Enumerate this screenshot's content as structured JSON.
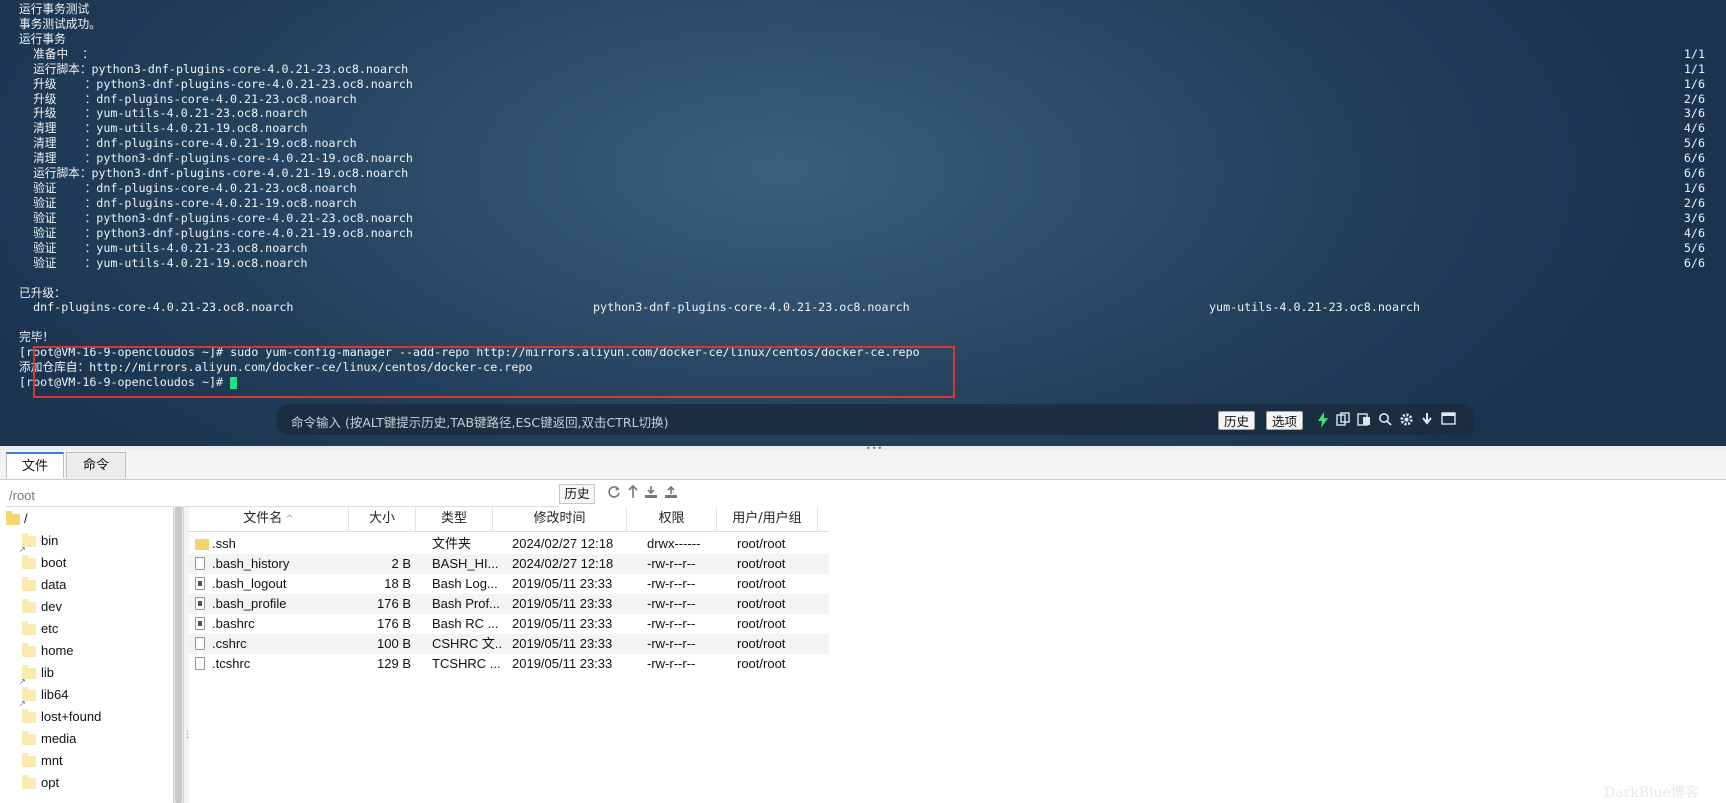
{
  "terminal": {
    "lines": [
      {
        "left": "运行事务测试"
      },
      {
        "left": "事务测试成功。"
      },
      {
        "left": "运行事务"
      },
      {
        "left": "  准备中  ：",
        "right": "1/1"
      },
      {
        "left": "  运行脚本：python3-dnf-plugins-core-4.0.21-23.oc8.noarch",
        "right": "1/1"
      },
      {
        "left": "  升级    ：python3-dnf-plugins-core-4.0.21-23.oc8.noarch",
        "right": "1/6"
      },
      {
        "left": "  升级    ：dnf-plugins-core-4.0.21-23.oc8.noarch",
        "right": "2/6"
      },
      {
        "left": "  升级    ：yum-utils-4.0.21-23.oc8.noarch",
        "right": "3/6"
      },
      {
        "left": "  清理    ：yum-utils-4.0.21-19.oc8.noarch",
        "right": "4/6"
      },
      {
        "left": "  清理    ：dnf-plugins-core-4.0.21-19.oc8.noarch",
        "right": "5/6"
      },
      {
        "left": "  清理    ：python3-dnf-plugins-core-4.0.21-19.oc8.noarch",
        "right": "6/6"
      },
      {
        "left": "  运行脚本：python3-dnf-plugins-core-4.0.21-19.oc8.noarch",
        "right": "6/6"
      },
      {
        "left": "  验证    ：dnf-plugins-core-4.0.21-23.oc8.noarch",
        "right": "1/6"
      },
      {
        "left": "  验证    ：dnf-plugins-core-4.0.21-19.oc8.noarch",
        "right": "2/6"
      },
      {
        "left": "  验证    ：python3-dnf-plugins-core-4.0.21-23.oc8.noarch",
        "right": "3/6"
      },
      {
        "left": "  验证    ：python3-dnf-plugins-core-4.0.21-19.oc8.noarch",
        "right": "4/6"
      },
      {
        "left": "  验证    ：yum-utils-4.0.21-23.oc8.noarch",
        "right": "5/6"
      },
      {
        "left": "  验证    ：yum-utils-4.0.21-19.oc8.noarch",
        "right": "6/6"
      },
      {
        "left": ""
      },
      {
        "left": "已升级："
      },
      {
        "left": "  dnf-plugins-core-4.0.21-23.oc8.noarch",
        "mid": "python3-dnf-plugins-core-4.0.21-23.oc8.noarch",
        "far": "yum-utils-4.0.21-23.oc8.noarch"
      },
      {
        "left": ""
      },
      {
        "left": "完毕！"
      },
      {
        "left": "[root@VM-16-9-opencloudos ~]# sudo yum-config-manager --add-repo http://mirrors.aliyun.com/docker-ce/linux/centos/docker-ce.repo"
      },
      {
        "left": "添加仓库自：http://mirrors.aliyun.com/docker-ce/linux/centos/docker-ce.repo"
      },
      {
        "left": "[root@VM-16-9-opencloudos ~]# ",
        "cursor": true
      }
    ],
    "command_bar": {
      "placeholder": "命令输入 (按ALT键提示历史,TAB键路径,ESC键返回,双击CTRL切换)",
      "history_label": "历史",
      "options_label": "选项",
      "icons": [
        "lightning-icon",
        "copy-icon",
        "paste-icon",
        "search-icon",
        "gear-icon",
        "download-arrow-icon",
        "window-icon"
      ]
    }
  },
  "tabs": [
    {
      "label": "文件",
      "active": true
    },
    {
      "label": "命令",
      "active": false
    }
  ],
  "path_bar": {
    "placeholder": "/root",
    "history_label": "历史",
    "icons": [
      "refresh-icon",
      "up-icon",
      "download-icon",
      "upload-icon"
    ]
  },
  "tree": {
    "root": "/",
    "items": [
      "bin",
      "boot",
      "data",
      "dev",
      "etc",
      "home",
      "lib",
      "lib64",
      "lost+found",
      "media",
      "mnt",
      "opt"
    ],
    "link_items": [
      "bin",
      "lib",
      "lib64"
    ]
  },
  "file_table": {
    "columns": [
      "文件名",
      "大小",
      "类型",
      "修改时间",
      "权限",
      "用户/用户组"
    ],
    "rows": [
      {
        "name": ".ssh",
        "size": "",
        "type": "文件夹",
        "modified": "2024/02/27 12:18",
        "perm": "drwx------",
        "owner": "root/root",
        "icon": "folder"
      },
      {
        "name": ".bash_history",
        "size": "2 B",
        "type": "BASH_HI...",
        "modified": "2024/02/27 12:18",
        "perm": "-rw-r--r--",
        "owner": "root/root",
        "icon": "file"
      },
      {
        "name": ".bash_logout",
        "size": "18 B",
        "type": "Bash Log...",
        "modified": "2019/05/11 23:33",
        "perm": "-rw-r--r--",
        "owner": "root/root",
        "icon": "script"
      },
      {
        "name": ".bash_profile",
        "size": "176 B",
        "type": "Bash Prof...",
        "modified": "2019/05/11 23:33",
        "perm": "-rw-r--r--",
        "owner": "root/root",
        "icon": "script"
      },
      {
        "name": ".bashrc",
        "size": "176 B",
        "type": "Bash RC ...",
        "modified": "2019/05/11 23:33",
        "perm": "-rw-r--r--",
        "owner": "root/root",
        "icon": "script"
      },
      {
        "name": ".cshrc",
        "size": "100 B",
        "type": "CSHRC 文...",
        "modified": "2019/05/11 23:33",
        "perm": "-rw-r--r--",
        "owner": "root/root",
        "icon": "file"
      },
      {
        "name": ".tcshrc",
        "size": "129 B",
        "type": "TCSHRC ...",
        "modified": "2019/05/11 23:33",
        "perm": "-rw-r--r--",
        "owner": "root/root",
        "icon": "file"
      }
    ]
  },
  "watermark": "DarkBlue博客"
}
